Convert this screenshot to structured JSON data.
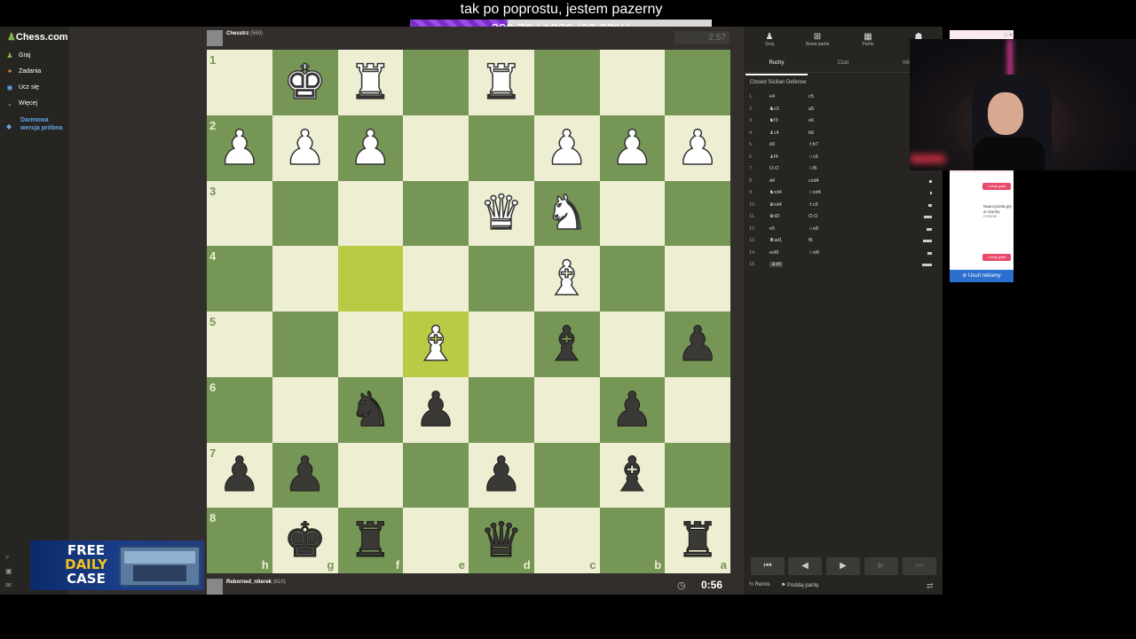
{
  "stream": {
    "title": "tak po poprostu, jestem pazerny",
    "goal_text": "329,70 / 1020 (32.32%)",
    "goal_progress": 0.3232
  },
  "sidebar": {
    "logo": "Chess.com",
    "items": [
      {
        "label": "Graj",
        "icon": "pawn-icon"
      },
      {
        "label": "Zadania",
        "icon": "puzzle-icon"
      },
      {
        "label": "Ucz się",
        "icon": "learn-icon"
      },
      {
        "label": "Więcej",
        "icon": "chevron-down-icon"
      }
    ],
    "trial": "Darmowa wersja próbna"
  },
  "top_player": {
    "name": "Chesstrz",
    "rating": "(569)",
    "clock": "2:57"
  },
  "bottom_player": {
    "name": "Reborned_niterek",
    "rating": "(610)",
    "clock": "0:56"
  },
  "board": {
    "ranks": [
      "1",
      "2",
      "3",
      "4",
      "5",
      "6",
      "7",
      "8"
    ],
    "files": [
      "h",
      "g",
      "f",
      "e",
      "d",
      "c",
      "b",
      "a"
    ],
    "highlight": [
      [
        3,
        2
      ],
      [
        4,
        3
      ]
    ],
    "pieces": [
      {
        "row": 0,
        "col": 1,
        "color": "w",
        "glyph": "♚"
      },
      {
        "row": 0,
        "col": 2,
        "color": "w",
        "glyph": "♜"
      },
      {
        "row": 0,
        "col": 4,
        "color": "w",
        "glyph": "♜"
      },
      {
        "row": 1,
        "col": 0,
        "color": "w",
        "glyph": "♟"
      },
      {
        "row": 1,
        "col": 1,
        "color": "w",
        "glyph": "♟"
      },
      {
        "row": 1,
        "col": 2,
        "color": "w",
        "glyph": "♟"
      },
      {
        "row": 1,
        "col": 5,
        "color": "w",
        "glyph": "♟"
      },
      {
        "row": 1,
        "col": 6,
        "color": "w",
        "glyph": "♟"
      },
      {
        "row": 1,
        "col": 7,
        "color": "w",
        "glyph": "♟"
      },
      {
        "row": 2,
        "col": 4,
        "color": "w",
        "glyph": "♛"
      },
      {
        "row": 2,
        "col": 5,
        "color": "w",
        "glyph": "♞"
      },
      {
        "row": 3,
        "col": 5,
        "color": "w",
        "glyph": "♝"
      },
      {
        "row": 4,
        "col": 3,
        "color": "w",
        "glyph": "♝"
      },
      {
        "row": 4,
        "col": 5,
        "color": "b",
        "glyph": "♝"
      },
      {
        "row": 4,
        "col": 7,
        "color": "b",
        "glyph": "♟"
      },
      {
        "row": 5,
        "col": 2,
        "color": "b",
        "glyph": "♞"
      },
      {
        "row": 5,
        "col": 3,
        "color": "b",
        "glyph": "♟"
      },
      {
        "row": 5,
        "col": 6,
        "color": "b",
        "glyph": "♟"
      },
      {
        "row": 6,
        "col": 0,
        "color": "b",
        "glyph": "♟"
      },
      {
        "row": 6,
        "col": 1,
        "color": "b",
        "glyph": "♟"
      },
      {
        "row": 6,
        "col": 4,
        "color": "b",
        "glyph": "♟"
      },
      {
        "row": 6,
        "col": 6,
        "color": "b",
        "glyph": "♝"
      },
      {
        "row": 7,
        "col": 1,
        "color": "b",
        "glyph": "♚"
      },
      {
        "row": 7,
        "col": 2,
        "color": "b",
        "glyph": "♜"
      },
      {
        "row": 7,
        "col": 4,
        "color": "b",
        "glyph": "♛"
      },
      {
        "row": 7,
        "col": 7,
        "color": "b",
        "glyph": "♜"
      }
    ]
  },
  "right_panel": {
    "tools": [
      {
        "label": "Graj",
        "icon": "pawn-icon"
      },
      {
        "label": "Nowa partia",
        "icon": "plus-icon"
      },
      {
        "label": "Partie",
        "icon": "board-icon"
      },
      {
        "label": "",
        "icon": "friends-icon"
      }
    ],
    "tabs": [
      "Ruchy",
      "Czat",
      "Infor"
    ],
    "opening": "Closed Sicilian Defense",
    "moves": [
      {
        "n": "1.",
        "w": "e4",
        "b": "c5",
        "t": 0
      },
      {
        "n": "2.",
        "w": "♞c3",
        "b": "a5",
        "t": 0
      },
      {
        "n": "3.",
        "w": "♞f3",
        "b": "e6",
        "t": 0
      },
      {
        "n": "4.",
        "w": "♝c4",
        "b": "b6",
        "t": 0
      },
      {
        "n": "5.",
        "w": "d3",
        "b": "♗b7",
        "t": 0
      },
      {
        "n": "6.",
        "w": "♝f4",
        "b": "♘c6",
        "t": 0
      },
      {
        "n": "7.",
        "w": "O-O",
        "b": "♘f6",
        "t": 0
      },
      {
        "n": "8.",
        "w": "d4",
        "b": "cxd4",
        "t": 0.2
      },
      {
        "n": "9.",
        "w": "♞xd4",
        "b": "♘xd4",
        "t": 0.15
      },
      {
        "n": "10.",
        "w": "♛xd4",
        "b": "♗c5",
        "t": 0.25
      },
      {
        "n": "11.",
        "w": "♛d3",
        "b": "O-O",
        "t": 0.55
      },
      {
        "n": "12.",
        "w": "e5",
        "b": "♘e8",
        "t": 0.35
      },
      {
        "n": "13.",
        "w": "♜ad1",
        "b": "f6",
        "t": 0.6
      },
      {
        "n": "14.",
        "w": "exf6",
        "b": "♘xf6",
        "t": 0.3
      },
      {
        "n": "15.",
        "w": "♝e5",
        "b": "",
        "t": 0.7
      }
    ],
    "controls": [
      "⏮",
      "◀",
      "▶",
      "▶",
      "⏭"
    ],
    "draw": "Remis",
    "resign": "Poddaj partię"
  },
  "ad": {
    "cta": "1 lekcja gratis",
    "text": "Nauczyciela gry w szachy",
    "sub": "Kraków",
    "remove": "Usuń reklamy"
  },
  "banner": {
    "line1": "FREE",
    "line2": "DAILY",
    "line3": "CASE"
  }
}
